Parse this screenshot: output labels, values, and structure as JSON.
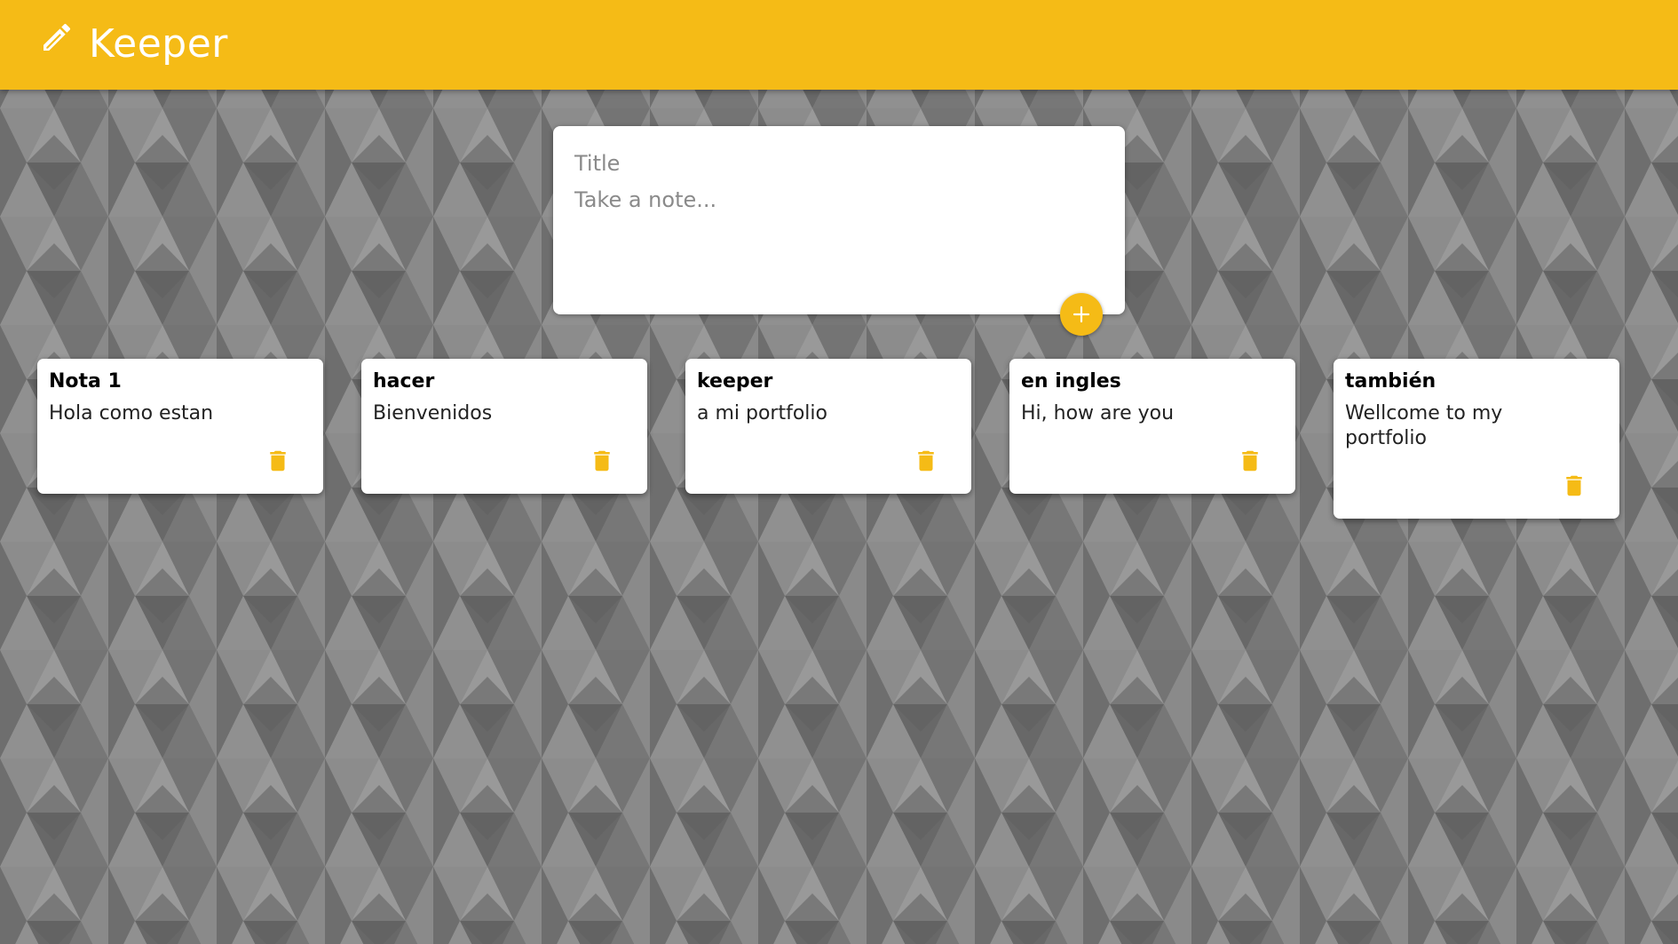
{
  "app": {
    "title": "Keeper",
    "logo_icon": "pencil-icon",
    "accent_color": "#f5bb16"
  },
  "composer": {
    "title_placeholder": "Title",
    "content_placeholder": "Take a note...",
    "add_icon": "plus-icon"
  },
  "notes": [
    {
      "title": "Nota 1",
      "content": "Hola como estan",
      "delete_icon": "trash-icon"
    },
    {
      "title": "hacer",
      "content": "Bienvenidos",
      "delete_icon": "trash-icon"
    },
    {
      "title": "keeper",
      "content": "a mi portfolio",
      "delete_icon": "trash-icon"
    },
    {
      "title": "en ingles",
      "content": "Hi, how are you",
      "delete_icon": "trash-icon"
    },
    {
      "title": "también",
      "content": "Wellcome to my portfolio",
      "delete_icon": "trash-icon"
    }
  ]
}
